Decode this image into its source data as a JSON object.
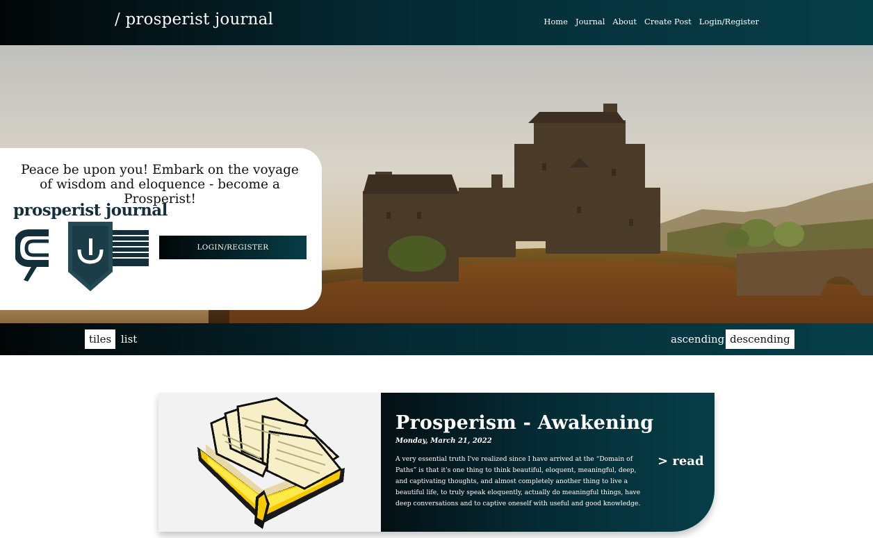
{
  "header": {
    "brand": "/ prosperist journal",
    "nav": [
      "Home",
      "Journal",
      "About",
      "Create Post",
      "Login/Register"
    ]
  },
  "hero": {
    "welcome_text": "Peace be upon you! Embark on the voyage of wisdom and eloquence - become a Prosperist!",
    "logo_text": "prosperist journal",
    "login_button": "LOGIN/REGISTER"
  },
  "view": {
    "tiles_label": "tiles",
    "list_label": "list",
    "ascending_label": "ascending",
    "descending_label": "descending",
    "active_layout": "tiles",
    "active_sort": "descending"
  },
  "posts": [
    {
      "title": "Prosperism - Awakening",
      "date": "Monday, March 21, 2022",
      "excerpt": "A very essential truth I've realized since I have arrived at the “Domain of Paths” is that it's one thing to think beautiful, eloquent, meaningful, deep, and captivating thoughts, and almost completely another thing to live a beautiful life, to truly speak eloquently, actually do meaningful things, have deep conversations and to captive oneself with useful and good knowledge.",
      "read_label": "> read",
      "thumbnail_icon": "open-book-icon"
    }
  ],
  "colors": {
    "accent_dark": "#020607",
    "accent_teal": "#063e48"
  }
}
